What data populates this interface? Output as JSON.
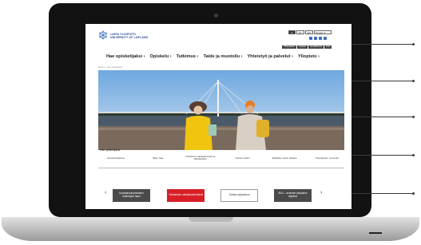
{
  "header": {
    "logo_line1": "LAPIN YLIOPISTO",
    "logo_line2": "UNIVERSITY OF LAPLAND",
    "languages": [
      "FI",
      "SV",
      "EN"
    ],
    "search_placeholder": "Google ▾"
  },
  "utility_links": [
    "Yhteystiedot",
    "Kirjasto",
    "Henkilökunta",
    "Intra"
  ],
  "main_nav": [
    "Hae opiskelijaksi ›",
    "Opiskelu ›",
    "Tutkimus ›",
    "Taide ja muotoilu ›",
    "Yhteistyö ja palvelut ›",
    "Yliopisto ›"
  ],
  "breadcrumb": "Etusivu › Hae opiskelijaksi",
  "section_title": "Hae opiskelijaksi",
  "tabs": [
    "Koulutusohjelmat",
    "Miten haet",
    "Yhteishaun valintaperusteet ja valintakokeet",
    "Tutustu meihin",
    "Erillishaut, avoin yliopisto",
    "Yhteystiedot / neuvonta"
  ],
  "carousel": {
    "prev": "‹",
    "next": "›",
    "cards": [
      {
        "label": "Korkeakouluyhteisten tutkintojen haku",
        "style": "dark"
      },
      {
        "label": "Yhteishaun valintakoetehtävät",
        "style": "red"
      },
      {
        "label": "Tutustu yliopistoon",
        "style": "white"
      },
      {
        "label": "AVO – avoimen yliopiston ohjelma",
        "style": "dark"
      }
    ]
  },
  "colors": {
    "accent": "#d81f26",
    "brand": "#1f3f8f",
    "dark": "#4a4a4a"
  }
}
